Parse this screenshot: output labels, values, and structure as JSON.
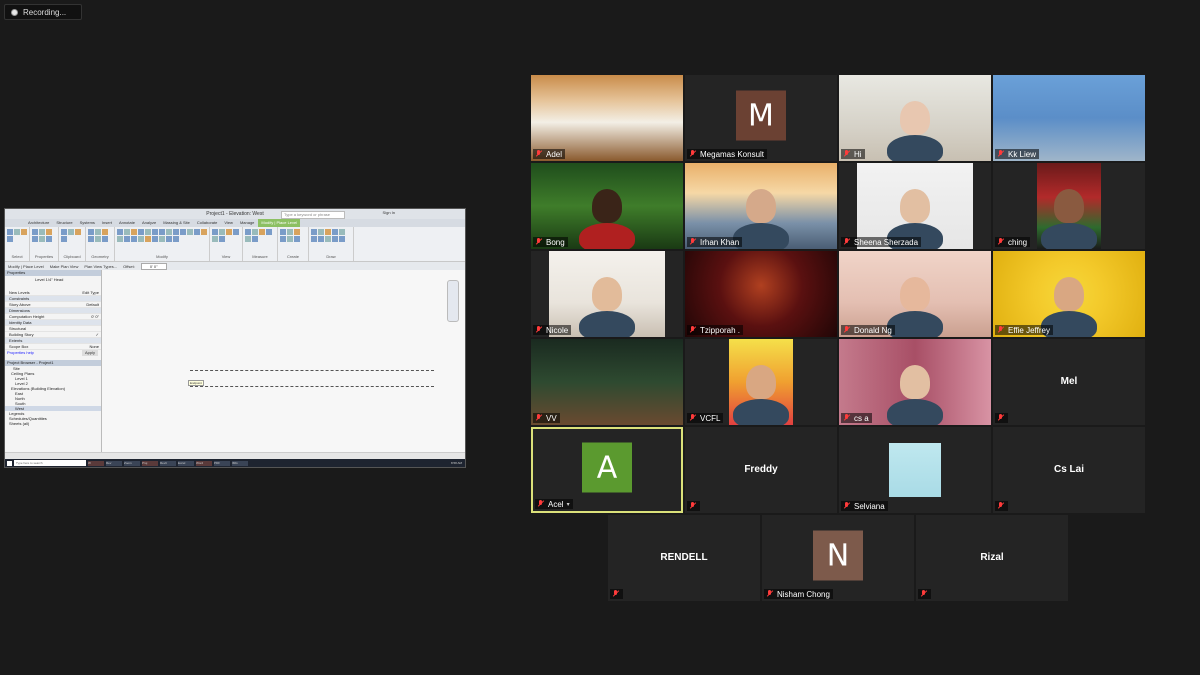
{
  "recording": {
    "label": "Recording..."
  },
  "share": {
    "window_title": "Project1 - Elevation: West",
    "search_placeholder": "Type a keyword or phrase",
    "signin": "Sign In",
    "tabs": [
      "Architecture",
      "Structure",
      "Systems",
      "Insert",
      "Annotate",
      "Analyze",
      "Massing & Site",
      "Collaborate",
      "View",
      "Manage",
      "Modify | Place Level"
    ],
    "ribbon_groups": [
      "Select",
      "Properties",
      "Clipboard",
      "Geometry",
      "Modify",
      "View",
      "Measure",
      "Create",
      "Draw"
    ],
    "options_bar": [
      "Modify | Place Level",
      "Make Plan View",
      "Plan View Types...",
      "Offset:",
      "0' 0\""
    ],
    "properties_title": "Properties",
    "type_selector": "Level 1/4\" Head",
    "new_levels": "New Levels",
    "edit_type": "Edit Type",
    "property_rows": [
      {
        "k": "Constraints",
        "v": "",
        "sec": true
      },
      {
        "k": "Story Above",
        "v": "Default"
      },
      {
        "k": "Dimensions",
        "v": "",
        "sec": true
      },
      {
        "k": "Computation Height",
        "v": "0' 0\""
      },
      {
        "k": "Identity Data",
        "v": "",
        "sec": true
      },
      {
        "k": "Structural",
        "v": ""
      },
      {
        "k": "Building Story",
        "v": "✓"
      },
      {
        "k": "Extents",
        "v": "",
        "sec": true
      },
      {
        "k": "Scope Box",
        "v": "None"
      }
    ],
    "properties_help": "Properties help",
    "apply": "Apply",
    "browser_title": "Project Browser - Project1",
    "browser_rows": [
      "Site",
      "Ceiling Plans",
      "Level 1",
      "Level 2",
      "Elevations (Building Elevation)",
      "East",
      "North",
      "South",
      "West",
      "Legends",
      "Schedules/Quantities",
      "Sheets (all)"
    ],
    "canvas_tip": "Endpoint",
    "taskbar_search": "Type here to search",
    "taskbar_apps": [
      "W",
      "Rev",
      "Zoom",
      "Proj",
      "Revit",
      "Excel",
      "Word",
      "PDF",
      "IMG"
    ],
    "clock": "8:58 AM"
  },
  "participants": [
    {
      "name": "Adel",
      "kind": "video",
      "scene": "room"
    },
    {
      "name": "Megamas Konsult",
      "kind": "initial",
      "initial": "M",
      "color": "#6b4133"
    },
    {
      "name": "Hi",
      "kind": "video",
      "scene": "shelf"
    },
    {
      "name": "Kk Liew",
      "kind": "video",
      "scene": "blue"
    },
    {
      "name": "Bong",
      "kind": "video",
      "scene": "jungle"
    },
    {
      "name": "Irhan Khan",
      "kind": "video",
      "scene": "bridge"
    },
    {
      "name": "Sheena Sherzada",
      "kind": "video",
      "scene": "white"
    },
    {
      "name": "ching",
      "kind": "video",
      "scene": "stadium"
    },
    {
      "name": "Nicole",
      "kind": "video",
      "scene": "books"
    },
    {
      "name": "Tzipporah .",
      "kind": "video",
      "scene": "lanterns"
    },
    {
      "name": "Donald Ng",
      "kind": "video",
      "scene": "pink"
    },
    {
      "name": "Effie Jeffrey",
      "kind": "video",
      "scene": "emoji"
    },
    {
      "name": "VV",
      "kind": "video",
      "scene": "livingroom"
    },
    {
      "name": "VCFL",
      "kind": "video",
      "scene": "poster"
    },
    {
      "name": "cs a",
      "kind": "video",
      "scene": "curtain"
    },
    {
      "name": "Mel",
      "kind": "name"
    },
    {
      "name": "Acel",
      "kind": "initial",
      "initial": "A",
      "color": "#5b9a2f",
      "active": true
    },
    {
      "name": "Freddy",
      "kind": "name"
    },
    {
      "name": "Selviana",
      "kind": "video",
      "scene": "illustration"
    },
    {
      "name": "Cs Lai",
      "kind": "name"
    },
    {
      "name": "RENDELL",
      "kind": "name"
    },
    {
      "name": "Nisham Chong",
      "kind": "initial",
      "initial": "N",
      "color": "#7d5a4b"
    },
    {
      "name": "Rizal",
      "kind": "name"
    }
  ]
}
